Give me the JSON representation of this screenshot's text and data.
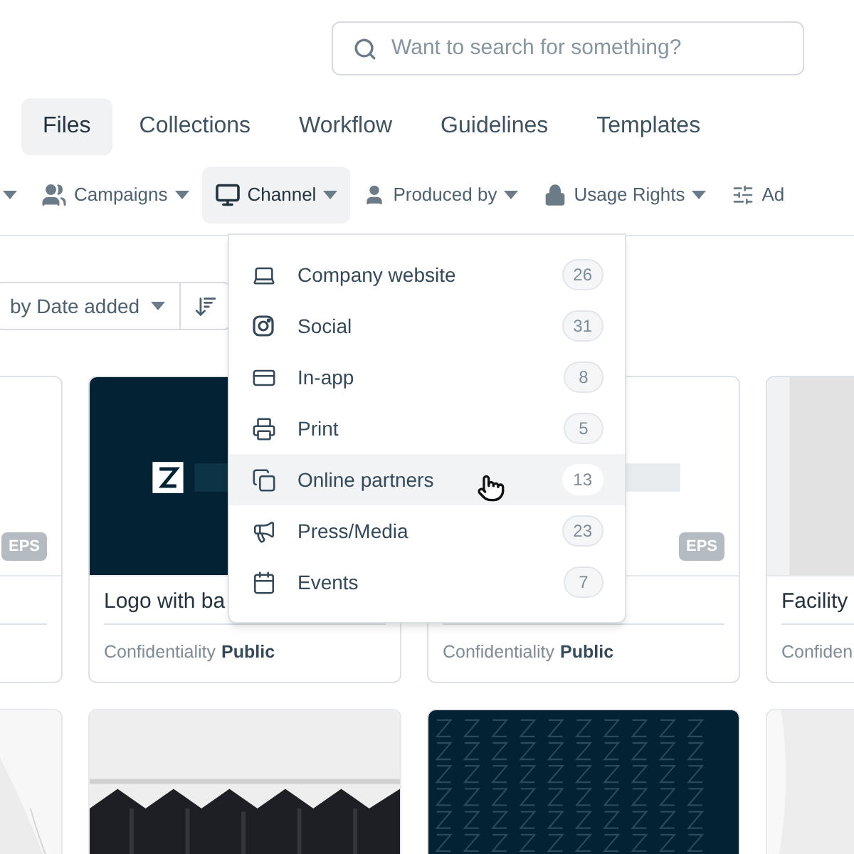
{
  "search": {
    "placeholder": "Want to search for something?"
  },
  "tabs": [
    {
      "label": "Files",
      "selected": true
    },
    {
      "label": "Collections",
      "selected": false
    },
    {
      "label": "Workflow",
      "selected": false
    },
    {
      "label": "Guidelines",
      "selected": false
    },
    {
      "label": "Templates",
      "selected": false
    }
  ],
  "filters": [
    {
      "kind": "caret",
      "selected": false
    },
    {
      "kind": "people",
      "label": "Campaigns",
      "selected": false
    },
    {
      "kind": "monitor",
      "label": "Channel",
      "selected": true
    },
    {
      "kind": "person",
      "label": "Produced by",
      "selected": false
    },
    {
      "kind": "lock",
      "label": "Usage Rights",
      "selected": false
    },
    {
      "kind": "sliders",
      "label": "Ad",
      "selected": false
    }
  ],
  "sort": {
    "label": "by Date added"
  },
  "channel_menu": [
    {
      "label": "Company website",
      "count": "26",
      "selected": false
    },
    {
      "label": "Social",
      "count": "31",
      "selected": false
    },
    {
      "label": "In-app",
      "count": "8",
      "selected": false
    },
    {
      "label": "Print",
      "count": "5",
      "selected": false
    },
    {
      "label": "Online partners",
      "count": "13",
      "selected": true
    },
    {
      "label": "Press/Media",
      "count": "23",
      "selected": false
    },
    {
      "label": "Events",
      "count": "7",
      "selected": false
    }
  ],
  "cards": [
    {
      "badge": "EPS"
    },
    {
      "title": "Logo with ba",
      "confidentiality_label": "Confidentiality",
      "confidentiality_value": "Public"
    },
    {
      "badge": "EPS",
      "confidentiality_label": "Confidentiality",
      "confidentiality_value": "Public"
    },
    {
      "title": "Facility",
      "confidentiality_label": "Confiden"
    }
  ]
}
